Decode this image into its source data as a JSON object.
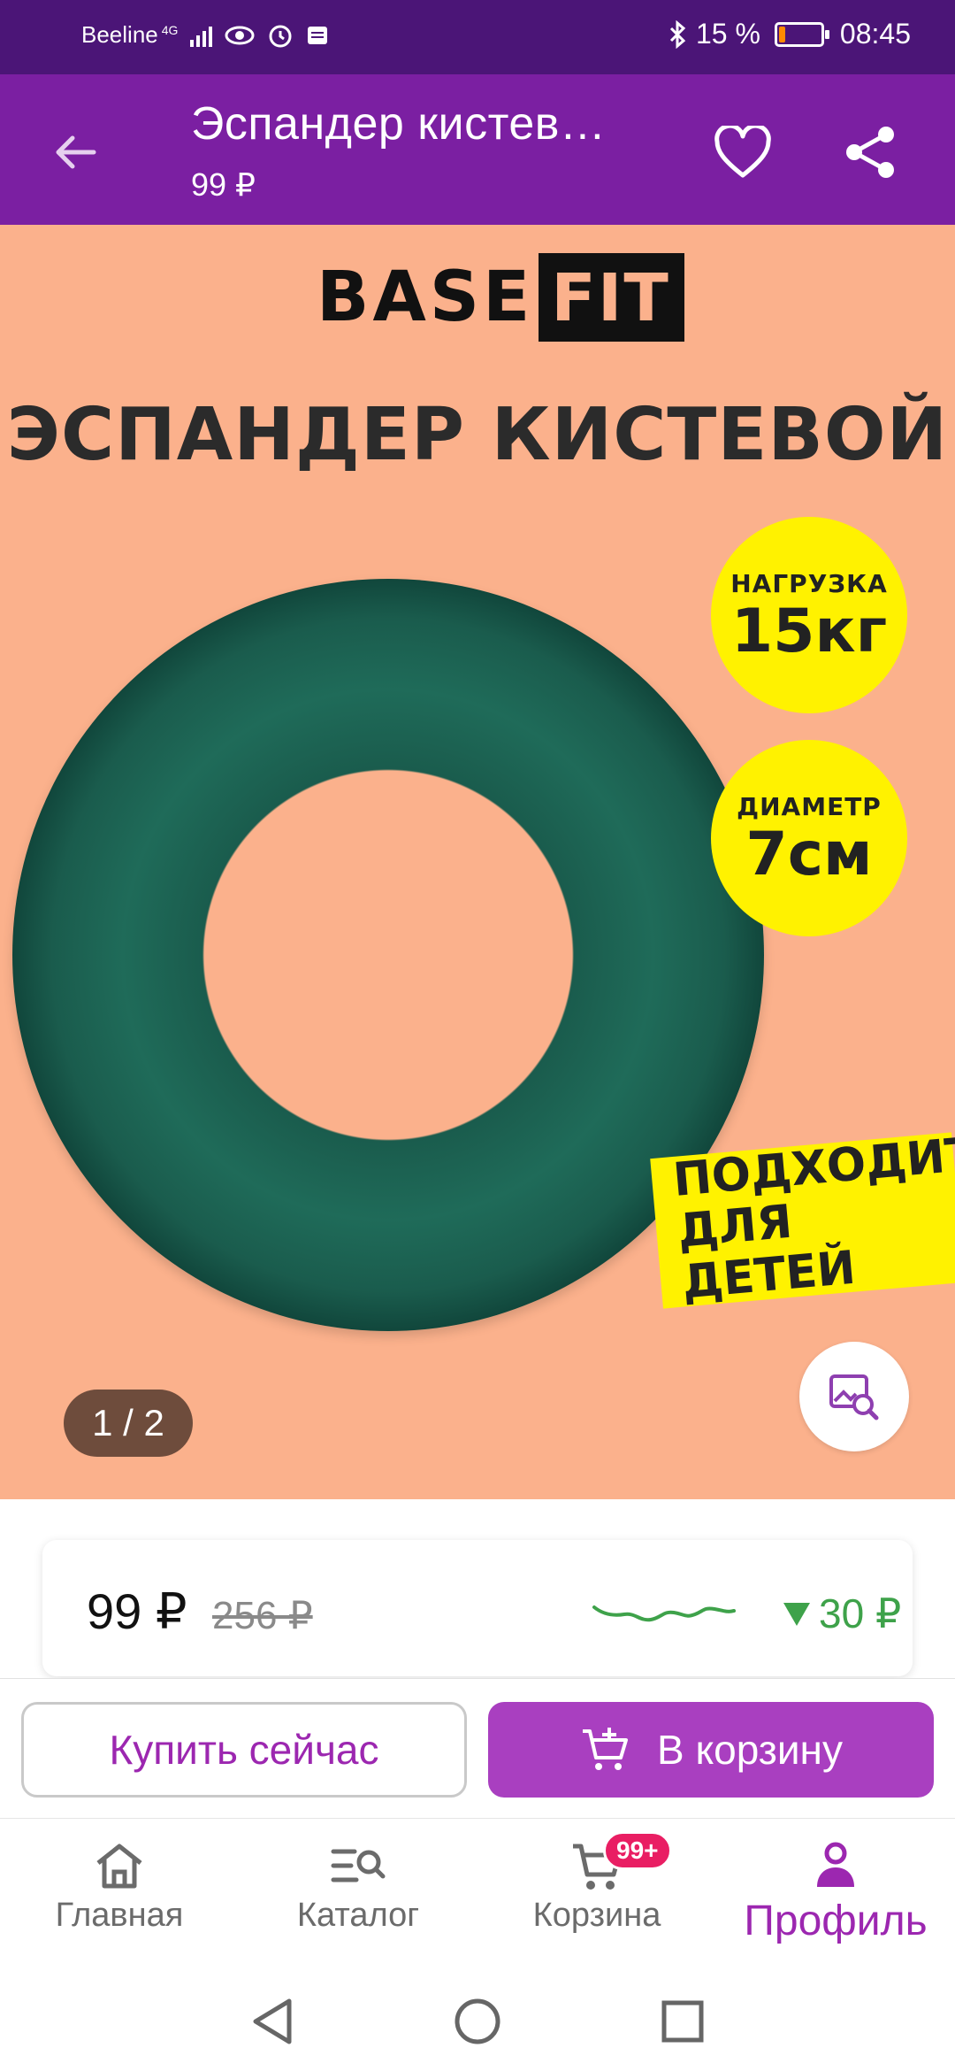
{
  "status_bar": {
    "carrier": "Beeline",
    "network": "4G",
    "battery": "15 %",
    "battery_level": 0.15,
    "time": "08:45"
  },
  "header": {
    "title": "Эспандер кистев…",
    "price": "99 ₽",
    "icons": [
      "arrow-left-icon",
      "heart-icon",
      "share-icon"
    ]
  },
  "hero": {
    "brand_base": "BASE",
    "brand_fit": "FIT",
    "product_name": "ЭСПАНДЕР КИСТЕВОЙ",
    "badge_load_label": "НАГРУЗКА",
    "badge_load_value": "15кг",
    "badge_diameter_label": "ДИАМЕТР",
    "badge_diameter_value": "7см",
    "kids_line1": "ПОДХОДИТ",
    "kids_line2": "ДЛЯ ДЕТЕЙ",
    "counter": "1 / 2",
    "colors": {
      "background": "#fbb18c",
      "ring": "#1a5c4d",
      "badge": "#fff200"
    }
  },
  "price_card": {
    "price": "99 ₽",
    "old_price": "256 ₽",
    "price_drop": "30 ₽",
    "drop_color": "#3ea24a"
  },
  "actions": {
    "buy_now": "Купить сейчас",
    "add_to_cart": "В корзину",
    "accent": "#9c27b0"
  },
  "bottom_nav": {
    "items": [
      {
        "label": "Главная",
        "icon": "home-icon"
      },
      {
        "label": "Каталог",
        "icon": "catalog-search-icon"
      },
      {
        "label": "Корзина",
        "icon": "cart-icon",
        "badge": "99+"
      },
      {
        "label": "Профиль",
        "icon": "profile-icon"
      }
    ],
    "active": "Профиль"
  }
}
